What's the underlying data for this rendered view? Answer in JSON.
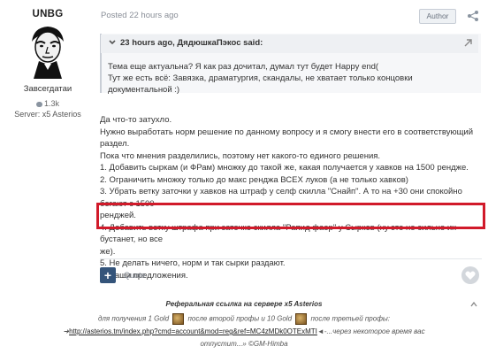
{
  "author": {
    "name": "UNBG",
    "rank": "Завсегдатаи",
    "reputation": "1.3k",
    "server": "Server: x5 Asterios"
  },
  "post": {
    "posted": "Posted 22 hours ago",
    "author_badge": "Author"
  },
  "quote": {
    "header": "23 hours ago, ДядюшкаПэкос said:",
    "lines": [
      "Тема еще актуальна? Я как раз дочитал, думал тут будет Happy end(",
      "Тут же есть всё: Завязка, драматургия, скандалы, не хватает только концовки документальной :)"
    ]
  },
  "content": {
    "lines": [
      "Да что-то затухло.",
      "Нужно выработать норм решение по данному вопросу и я смогу внести его в соответствующий",
      "раздел.",
      "Пока что мнения разделились, поэтому нет какого-то единого решения.",
      "1. Добавить сыркам (и ФРам) множку до такой же, какая получается у хавков на 1500 рендже.",
      "2. Ограничить множку только до макс ренджа ВСЕХ луков (а не только хавков)",
      "3. Убрать ветку заточки у хавков на штраф у селф скилла \"Снайп\". А то на +30 они спокойно бегают с 1500",
      "ренджей.",
      "4. Добавить ветку штрафа при заточке скилла \"Рапид фаер\" у Сырков (ну это не сильно их бустанет, но все",
      "же).",
      "5. Не делать ничего, норм и так сырки раздают.",
      "6. Ваши предложения."
    ]
  },
  "actions": {
    "plus": "+",
    "quote": "Quote"
  },
  "signature": {
    "line1": "Реферальная ссылка на сервере x5 Asterios",
    "line2a": "для получения 1 Gold",
    "line2b": "после второй профы и 10 Gold",
    "line2c": "после третьей профы:",
    "line3_link": "http://asterios.tm/index.php?cmd=account&mod=reg&ref=MC4zMDk0OTExMTI",
    "line3_pre": "➜",
    "line3_post": "◄-...через некоторое время вас",
    "line4": "отпустит...» ©GM-Himba"
  }
}
